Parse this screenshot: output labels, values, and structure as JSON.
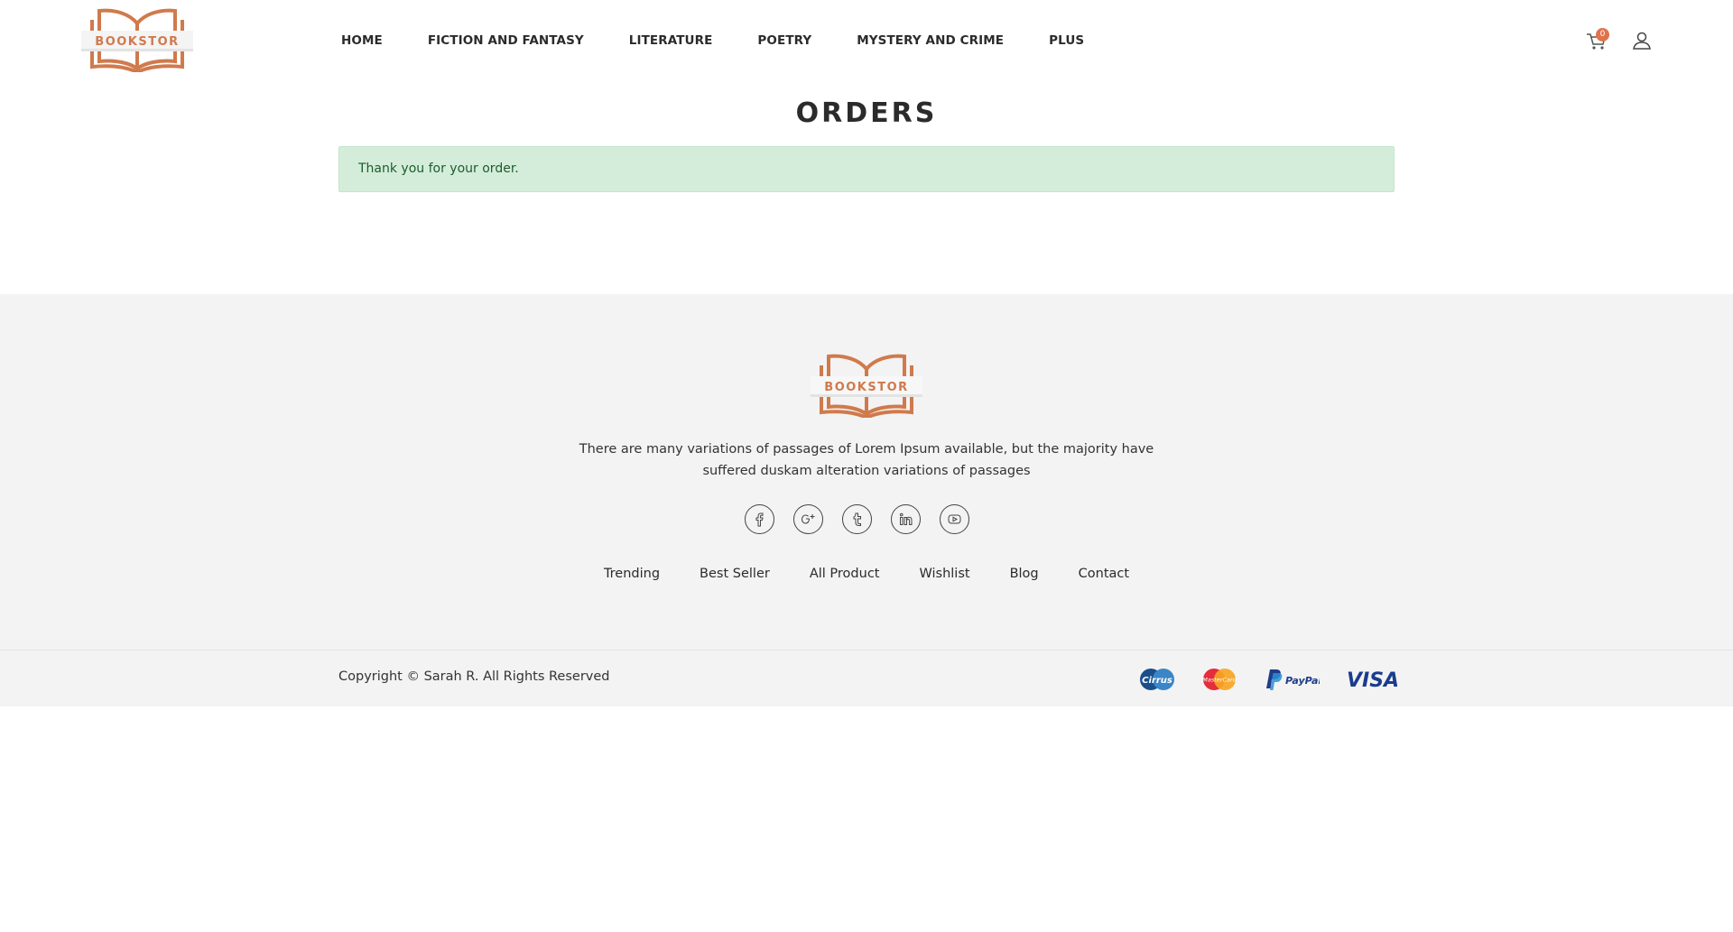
{
  "header": {
    "logo_text": "BOOKSTOR",
    "nav": [
      "HOME",
      "FICTION AND FANTASY",
      "LITERATURE",
      "POETRY",
      "MYSTERY AND CRIME",
      "PLUS"
    ],
    "cart_count": "0"
  },
  "main": {
    "title": "ORDERS",
    "alert": "Thank you for your order."
  },
  "footer": {
    "logo_text": "BOOKSTOR",
    "description": "There are many variations of passages of Lorem Ipsum available, but the majority have suffered duskam alteration variations of passages",
    "social_icons": [
      "facebook-icon",
      "google-plus-icon",
      "tumblr-icon",
      "linkedin-icon",
      "youtube-icon"
    ],
    "links": [
      "Trending",
      "Best Seller",
      "All Product",
      "Wishlist",
      "Blog",
      "Contact"
    ],
    "copyright": "Copyright © Sarah R. All Rights Reserved",
    "payments": [
      "Cirrus",
      "MasterCard",
      "PayPal",
      "VISA"
    ]
  },
  "colors": {
    "brand": "#d07a4c",
    "alert_bg": "#d4edda",
    "alert_text": "#1d5c2c",
    "footer_bg": "#f3f3f3",
    "badge": "#e0734a"
  }
}
